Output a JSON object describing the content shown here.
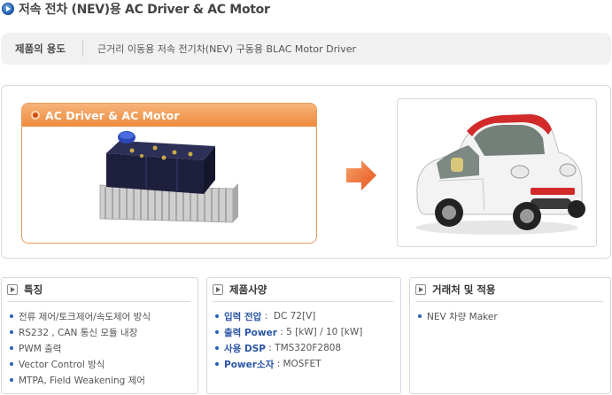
{
  "page": {
    "title": "저속 전차 (NEV)용 AC Driver & AC Motor"
  },
  "usage": {
    "label": "제품의 용도",
    "value": "근거리 이동용 저속 전기차(NEV) 구동용 BLAC Motor Driver"
  },
  "showcase": {
    "product_card_title": "AC Driver & AC Motor"
  },
  "colors": {
    "accent_orange": "#ee8b3d",
    "title_blue": "#1f5fb0",
    "spec_blue": "#2a55a5"
  },
  "icons": [
    "title-bullet-icon",
    "orange-dot-icon",
    "right-arrow-icon",
    "play-icon"
  ],
  "features": {
    "title": "특징",
    "items": [
      "전류 제어/토크제어/속도제어 방식",
      "RS232 , CAN 통신 모듈 내장",
      "PWM 출력",
      "Vector Control 방식",
      "MTPA, Field Weakening 제어"
    ]
  },
  "specs": {
    "title": "제품사양",
    "items": [
      {
        "key": "입력 전압",
        "sep": " :  ",
        "value": "DC 72[V]"
      },
      {
        "key": "출력 Power",
        "sep": " : ",
        "value": "5 [kW] / 10 [kW]"
      },
      {
        "key": "사용 DSP",
        "sep": " : ",
        "value": "TMS320F2808"
      },
      {
        "key": "Power소자",
        "sep": " : ",
        "value": "MOSFET"
      }
    ]
  },
  "customers": {
    "title": "거래처 및 적용",
    "items": [
      "NEV 차량 Maker"
    ]
  }
}
